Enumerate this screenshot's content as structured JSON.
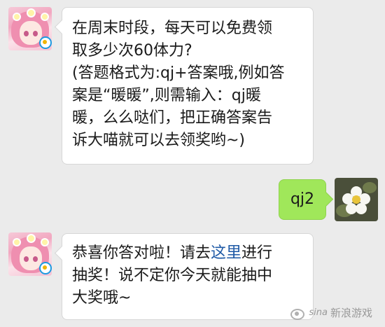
{
  "messages": [
    {
      "sender": "game-account",
      "lines": [
        "在周末时段，每天可以免费领",
        "取多少次60体力?",
        "(答题格式为:qj+答案哦,例如答",
        "案是“暖暖”,则需输入：qj暖",
        "暖，么么哒们，把正确答案告",
        "诉大喵就可以去领奖哟~)"
      ]
    },
    {
      "sender": "user",
      "text": "qj2"
    },
    {
      "sender": "game-account",
      "line1_before": "恭喜你答对啦！请去",
      "line1_link": "这里",
      "line1_after": "进行",
      "line2": "抽奖！说不定你今天就能抽中",
      "line3": "大奖哦~"
    }
  ],
  "watermark": {
    "brand": "sina",
    "text": "新浪游戏"
  },
  "colors": {
    "background": "#ebebeb",
    "incoming_bubble": "#ffffff",
    "outgoing_bubble": "#a0e75a",
    "link": "#1f5aa6"
  },
  "icons": {
    "game_avatar": "anime-girl-avatar",
    "user_avatar": "white-flower-avatar",
    "watermark_logo": "sina-eye-logo"
  }
}
